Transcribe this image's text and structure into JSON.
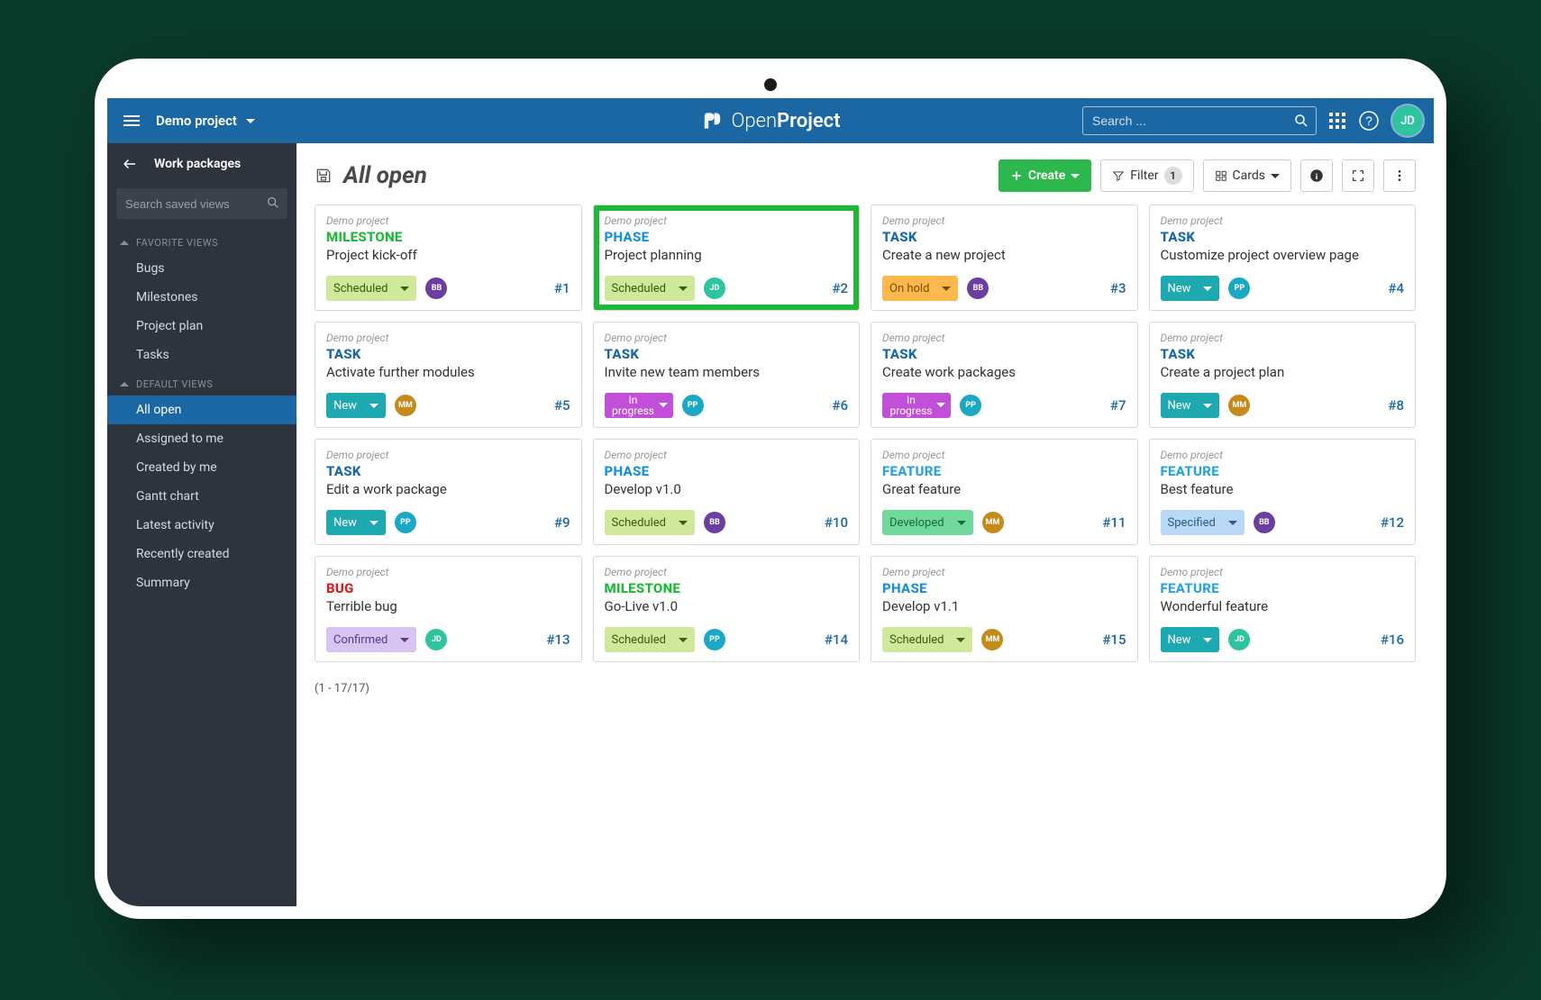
{
  "header": {
    "project_name": "Demo project",
    "brand_pre": "Open",
    "brand_post": "Project",
    "search_placeholder": "Search ...",
    "avatar_initials": "JD"
  },
  "sidebar": {
    "title": "Work packages",
    "search_placeholder": "Search saved views",
    "groups": [
      {
        "label": "FAVORITE VIEWS",
        "items": [
          "Bugs",
          "Milestones",
          "Project plan",
          "Tasks"
        ]
      },
      {
        "label": "DEFAULT VIEWS",
        "items": [
          "All open",
          "Assigned to me",
          "Created by me",
          "Gantt chart",
          "Latest activity",
          "Recently created",
          "Summary"
        ]
      }
    ],
    "active": "All open"
  },
  "main": {
    "title": "All open",
    "create_label": "Create",
    "filter_label": "Filter",
    "filter_count": "1",
    "view_label": "Cards",
    "pager": "(1 - 17/17)"
  },
  "type_colors": {
    "MILESTONE": "#1fb836",
    "PHASE": "#1a8fd8",
    "TASK": "#1a67a3",
    "FEATURE": "#2aa3e0",
    "BUG": "#d42020"
  },
  "status_styles": {
    "Scheduled": {
      "bg": "#cfe89a",
      "fg": "#3a5a10"
    },
    "On hold": {
      "bg": "#ffb84d",
      "fg": "#7a4a00"
    },
    "New": {
      "bg": "#1ea9b0",
      "fg": "#ffffff"
    },
    "In progress": {
      "bg": "#c24fd8",
      "fg": "#ffffff"
    },
    "Developed": {
      "bg": "#6fd89a",
      "fg": "#1a6b3a"
    },
    "Specified": {
      "bg": "#b8d8f5",
      "fg": "#2a5a8a"
    },
    "Confirmed": {
      "bg": "#d8c4f0",
      "fg": "#5a3a8a"
    }
  },
  "avatar_colors": {
    "BB": "#6b3fa0",
    "JD": "#2ec4a0",
    "PP": "#1aa8c4",
    "MM": "#c48a1a"
  },
  "cards": [
    {
      "project": "Demo project",
      "type": "MILESTONE",
      "title": "Project kick-off",
      "status": "Scheduled",
      "assignee": "BB",
      "num": "#1",
      "highlight": false
    },
    {
      "project": "Demo project",
      "type": "PHASE",
      "title": "Project planning",
      "status": "Scheduled",
      "assignee": "JD",
      "num": "#2",
      "highlight": true
    },
    {
      "project": "Demo project",
      "type": "TASK",
      "title": "Create a new project",
      "status": "On hold",
      "assignee": "BB",
      "num": "#3",
      "highlight": false
    },
    {
      "project": "Demo project",
      "type": "TASK",
      "title": "Customize project overview page",
      "status": "New",
      "assignee": "PP",
      "num": "#4",
      "highlight": false
    },
    {
      "project": "Demo project",
      "type": "TASK",
      "title": "Activate further modules",
      "status": "New",
      "assignee": "MM",
      "num": "#5",
      "highlight": false
    },
    {
      "project": "Demo project",
      "type": "TASK",
      "title": "Invite new team members",
      "status": "In progress",
      "assignee": "PP",
      "num": "#6",
      "highlight": false
    },
    {
      "project": "Demo project",
      "type": "TASK",
      "title": "Create work packages",
      "status": "In progress",
      "assignee": "PP",
      "num": "#7",
      "highlight": false
    },
    {
      "project": "Demo project",
      "type": "TASK",
      "title": "Create a project plan",
      "status": "New",
      "assignee": "MM",
      "num": "#8",
      "highlight": false
    },
    {
      "project": "Demo project",
      "type": "TASK",
      "title": "Edit a work package",
      "status": "New",
      "assignee": "PP",
      "num": "#9",
      "highlight": false
    },
    {
      "project": "Demo project",
      "type": "PHASE",
      "title": "Develop v1.0",
      "status": "Scheduled",
      "assignee": "BB",
      "num": "#10",
      "highlight": false
    },
    {
      "project": "Demo project",
      "type": "FEATURE",
      "title": "Great feature",
      "status": "Developed",
      "assignee": "MM",
      "num": "#11",
      "highlight": false
    },
    {
      "project": "Demo project",
      "type": "FEATURE",
      "title": "Best feature",
      "status": "Specified",
      "assignee": "BB",
      "num": "#12",
      "highlight": false
    },
    {
      "project": "Demo project",
      "type": "BUG",
      "title": "Terrible bug",
      "status": "Confirmed",
      "assignee": "JD",
      "num": "#13",
      "highlight": false
    },
    {
      "project": "Demo project",
      "type": "MILESTONE",
      "title": "Go-Live v1.0",
      "status": "Scheduled",
      "assignee": "PP",
      "num": "#14",
      "highlight": false
    },
    {
      "project": "Demo project",
      "type": "PHASE",
      "title": "Develop v1.1",
      "status": "Scheduled",
      "assignee": "MM",
      "num": "#15",
      "highlight": false
    },
    {
      "project": "Demo project",
      "type": "FEATURE",
      "title": "Wonderful feature",
      "status": "New",
      "assignee": "JD",
      "num": "#16",
      "highlight": false
    }
  ]
}
